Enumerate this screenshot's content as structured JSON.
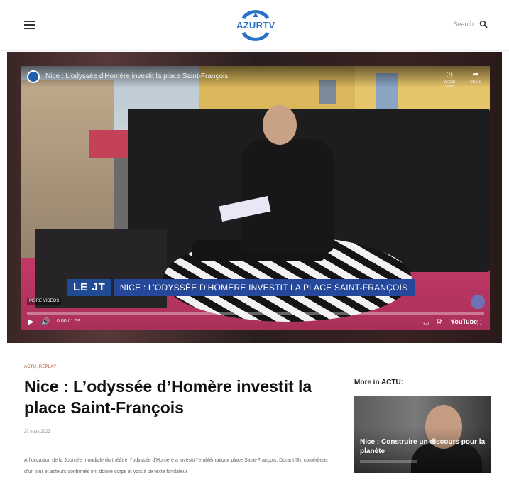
{
  "header": {
    "logo_text": "AZURTV",
    "search_label": "Search",
    "brand_color": "#2a72c8"
  },
  "video": {
    "title": "Nice : L'odyssée d'Homère investit la place Saint-François",
    "watch_later_label": "Watch later",
    "share_label": "Share",
    "lower_third_label": "LE JT",
    "lower_third_text": "NICE : L’ODYSSÉE D’HOMÈRE INVESTIT LA PLACE SAINT-FRANÇOIS",
    "more_videos_label": "MORE VIDEOS",
    "time": "0:00 / 1:59",
    "progress": 0,
    "youtube_label": "YouTube",
    "icons": {
      "play": "play-icon",
      "volume": "volume-icon",
      "subtitles": "subtitles-icon",
      "settings": "gear-icon",
      "fullscreen": "fullscreen-icon"
    }
  },
  "article": {
    "category_primary": "ACTU",
    "category_secondary": "REPLAY",
    "headline": "Nice : L’odyssée d’Homère investit la place Saint-François",
    "date": "27 mars 2023",
    "excerpt": "À l’occasion de la Journée mondiale du théâtre, l’odyssée d’Homère a investit l’emblématique place Saint-François. Durant 5h, comédiens d’un jour et acteurs confirmés ont donné corps et voix à ce texte fondateur",
    "category_color": "#b85a2e"
  },
  "sidebar": {
    "title": "More in ACTU:",
    "card_title": "Nice : Construire un discours pour la planète"
  }
}
